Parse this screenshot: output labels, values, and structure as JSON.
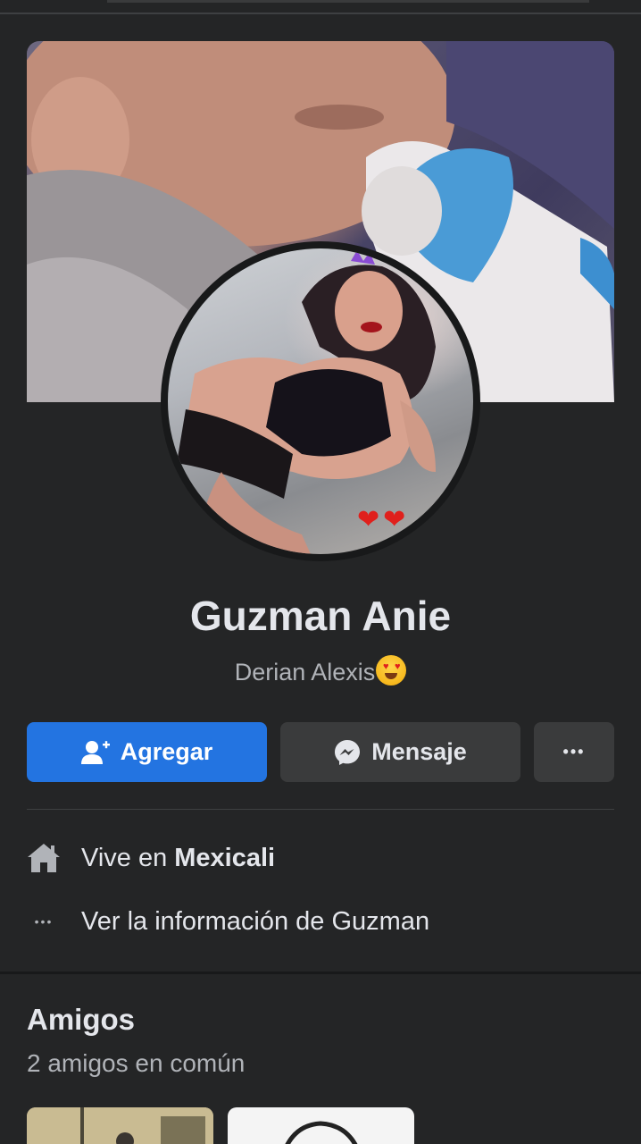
{
  "profile": {
    "name": "Guzman Anie",
    "subtitle": "Derian Alexis",
    "subtitle_emoji": "star-struck-heart-eyes-emoji",
    "avatar_hearts": "❤❤"
  },
  "actions": {
    "add_label": "Agregar",
    "message_label": "Mensaje",
    "more_label": "•••"
  },
  "intro": {
    "lives_prefix": "Vive en",
    "lives_city": "Mexicali",
    "more_info": "Ver la información de Guzman",
    "more_info_dots": "•••"
  },
  "friends": {
    "title": "Amigos",
    "mutual": "2 amigos en común"
  },
  "colors": {
    "background": "#242526",
    "primary_button": "#2374e1",
    "secondary_button": "#3a3b3c",
    "text_primary": "#e4e6eb",
    "text_secondary": "#b0b3b8"
  },
  "icons": {
    "add_friend": "add-friend-icon",
    "messenger": "messenger-icon",
    "home": "home-icon",
    "more": "more-dots-icon"
  }
}
